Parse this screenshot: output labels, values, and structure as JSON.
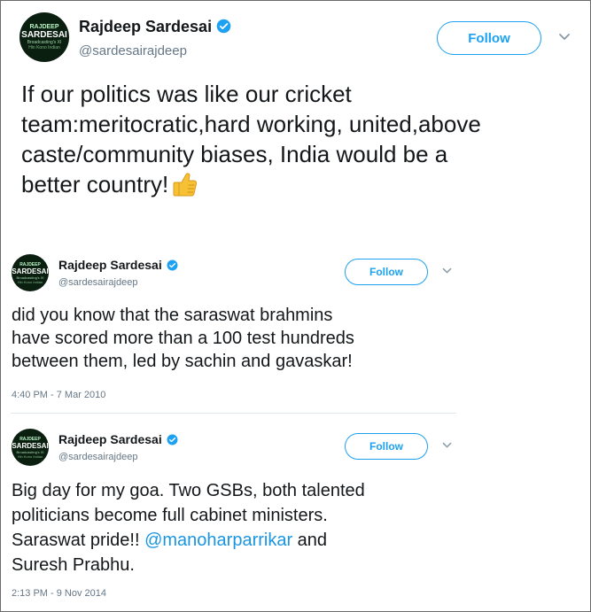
{
  "tweets": [
    {
      "avatar_lines": [
        "RAJDEEP",
        "SARDESAI",
        "Broadcasting's XI",
        "Hin Kono Indian"
      ],
      "name": "Rajdeep Sardesai",
      "handle": "@sardesairajdeep",
      "follow_label": "Follow",
      "lines": [
        "If our politics was like our cricket",
        "team:meritocratic,hard working, united,above",
        "caste/community biases, India would be a",
        "better country!"
      ],
      "emoji": "👍"
    },
    {
      "avatar_lines": [
        "RAJDEEP",
        "SARDESAI",
        "Broadcasting's XI",
        "Hin Kono Indian"
      ],
      "name": "Rajdeep Sardesai",
      "handle": "@sardesairajdeep",
      "follow_label": "Follow",
      "lines": [
        "did you know that the saraswat brahmins",
        "have scored more than a 100 test hundreds",
        "between them, led by sachin and gavaskar!"
      ],
      "timestamp": "4:40 PM - 7 Mar 2010"
    },
    {
      "avatar_lines": [
        "RAJDEEP",
        "SARDESAI",
        "Broadcasting's XI",
        "Hin Kono Indian"
      ],
      "name": "Rajdeep Sardesai",
      "handle": "@sardesairajdeep",
      "follow_label": "Follow",
      "lines": [
        "Big day for my goa. Two GSBs, both talented",
        "politicians become full cabinet ministers.",
        "Saraswat pride!! ",
        "Suresh Prabhu."
      ],
      "mention": "@manoharparrikar",
      "after_mention": " and",
      "timestamp": "2:13 PM - 9 Nov 2014"
    }
  ],
  "colors": {
    "accent": "#1da1f2",
    "mention": "#1b95e0",
    "secondary_text": "#657786",
    "emoji": "#f7c136"
  },
  "icons": [
    "verified-badge-icon",
    "chevron-down-icon",
    "thumbs-up-emoji"
  ]
}
